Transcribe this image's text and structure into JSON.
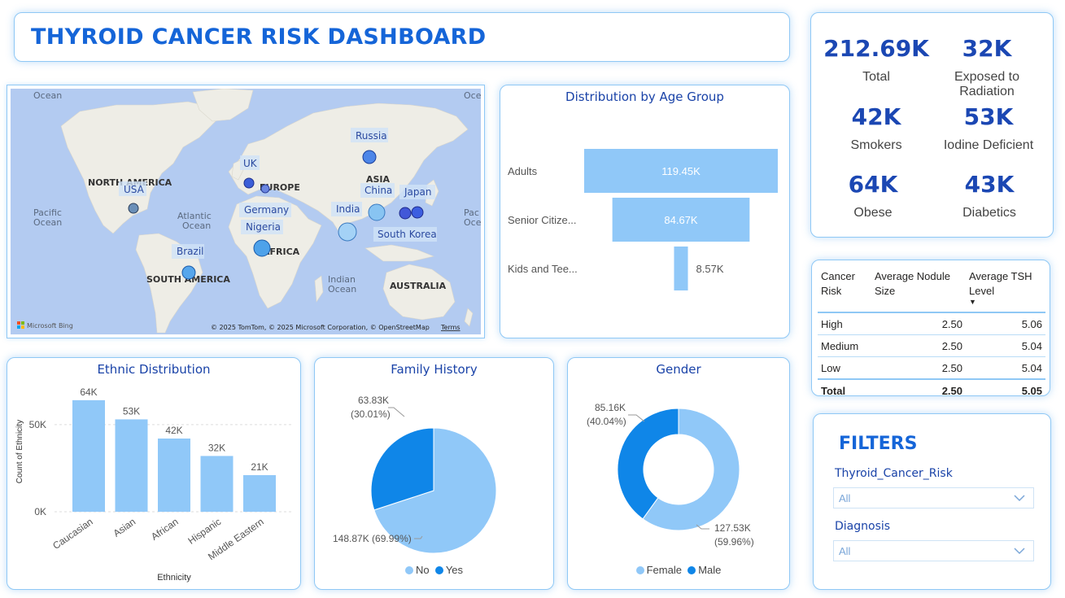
{
  "title": "THYROID CANCER RISK DASHBOARD",
  "colors": {
    "accent": "#1565d8",
    "light_blue": "#90c8f8",
    "dark_blue": "#0f86e8",
    "title_blue": "#1a43a8"
  },
  "kpis": [
    {
      "value": "212.69K",
      "label": "Total"
    },
    {
      "value": "32K",
      "label": "Exposed to Radiation"
    },
    {
      "value": "42K",
      "label": "Smokers"
    },
    {
      "value": "53K",
      "label": "Iodine Deficient"
    },
    {
      "value": "64K",
      "label": "Obese"
    },
    {
      "value": "43K",
      "label": "Diabetics"
    }
  ],
  "map": {
    "ocean_labels": [
      "Ocean",
      "Oce",
      "Pacific Ocean",
      "Atlantic Ocean",
      "Indian Ocean",
      "Pacific Oce"
    ],
    "continents": [
      "NORTH AMERICA",
      "EUROPE",
      "ASIA",
      "AFRICA",
      "SOUTH AMERICA",
      "AUSTRALIA"
    ],
    "countries": [
      "UK",
      "USA",
      "Germany",
      "Nigeria",
      "Brazil",
      "Russia",
      "China",
      "India",
      "Japan",
      "South Korea"
    ],
    "attribution": "© 2025 TomTom, © 2025 Microsoft Corporation, © OpenStreetMap",
    "terms": "Terms",
    "bing": "Microsoft Bing"
  },
  "age": {
    "title": "Distribution by Age Group",
    "chart_data": {
      "type": "bar",
      "categories": [
        "Adults",
        "Senior Citize...",
        "Kids and Tee..."
      ],
      "values": [
        119.45,
        84.67,
        8.57
      ],
      "labels": [
        "119.45K",
        "84.67K",
        "8.57K"
      ]
    }
  },
  "table": {
    "headers": [
      "Cancer Risk",
      "Average Nodule Size",
      "Average TSH Level"
    ],
    "rows": [
      [
        "High",
        "2.50",
        "5.06"
      ],
      [
        "Medium",
        "2.50",
        "5.04"
      ],
      [
        "Low",
        "2.50",
        "5.04"
      ]
    ],
    "total": [
      "Total",
      "2.50",
      "5.05"
    ]
  },
  "ethnic": {
    "title": "Ethnic Distribution",
    "chart_data": {
      "type": "bar",
      "categories": [
        "Caucasian",
        "Asian",
        "African",
        "Hispanic",
        "Middle Eastern"
      ],
      "values": [
        64,
        53,
        42,
        32,
        21
      ],
      "labels": [
        "64K",
        "53K",
        "42K",
        "32K",
        "21K"
      ],
      "xlabel": "Ethnicity",
      "ylabel": "Count of Ethnicity",
      "yticks": [
        "0K",
        "50K"
      ],
      "ylim": [
        0,
        70
      ]
    }
  },
  "family": {
    "title": "Family History",
    "chart_data": {
      "type": "pie",
      "categories": [
        "No",
        "Yes"
      ],
      "values": [
        148.87,
        63.83
      ],
      "percents": [
        69.99,
        30.01
      ],
      "labels_value": [
        "148.87K (69.99%)",
        "63.83K"
      ],
      "labels_pct": [
        "",
        "(30.01%)"
      ]
    }
  },
  "gender": {
    "title": "Gender",
    "chart_data": {
      "type": "pie",
      "categories": [
        "Female",
        "Male"
      ],
      "values": [
        127.53,
        85.16
      ],
      "percents": [
        59.96,
        40.04
      ],
      "labels_value": [
        "127.53K",
        "85.16K"
      ],
      "labels_pct": [
        "(59.96%)",
        "(40.04%)"
      ]
    }
  },
  "filters": {
    "heading": "FILTERS",
    "items": [
      {
        "label": "Thyroid_Cancer_Risk",
        "value": "All"
      },
      {
        "label": "Diagnosis",
        "value": "All"
      }
    ]
  }
}
